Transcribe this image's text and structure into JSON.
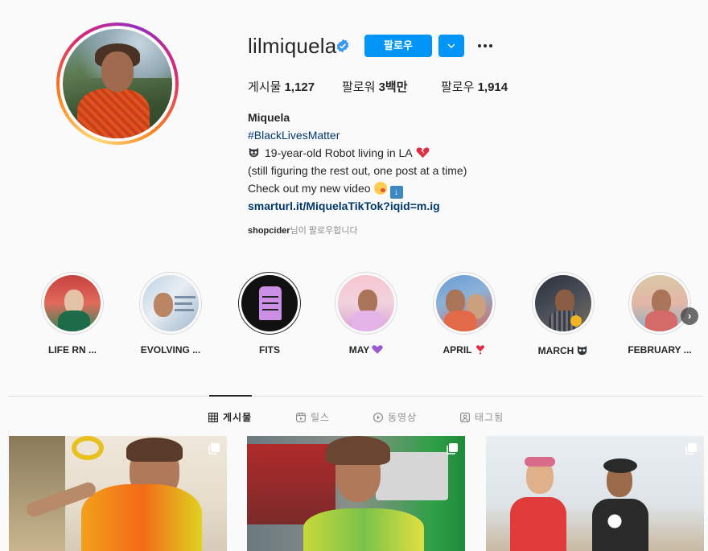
{
  "profile": {
    "username": "lilmiquela",
    "follow_label": "팔로우",
    "stats": {
      "posts_label": "게시물",
      "posts_value": "1,127",
      "followers_label": "팔로워",
      "followers_value": "3백만",
      "following_label": "팔로우",
      "following_value": "1,914"
    },
    "bio": {
      "name": "Miquela",
      "hashtag": "#BlackLivesMatter",
      "line1": "19-year-old Robot living in LA",
      "line2": "(still figuring the rest out, one post at a time)",
      "line3": "Check out my new video",
      "link": "smarturl.it/MiquelaTikTok?iqid=m.ig"
    },
    "followed_by": {
      "user": "shopcider",
      "suffix": "님이 팔로우합니다"
    }
  },
  "highlights": [
    {
      "label": "LIFE RN ..."
    },
    {
      "label": "EVOLVING ..."
    },
    {
      "label": "FITS"
    },
    {
      "label": "MAY"
    },
    {
      "label": "APRIL"
    },
    {
      "label": "MARCH"
    },
    {
      "label": "FEBRUARY ..."
    }
  ],
  "tabs": [
    {
      "label": "게시물",
      "icon": "grid-icon",
      "active": true
    },
    {
      "label": "릴스",
      "icon": "reels-icon",
      "active": false
    },
    {
      "label": "동영상",
      "icon": "play-circle-icon",
      "active": false
    },
    {
      "label": "태그됨",
      "icon": "tag-icon",
      "active": false
    }
  ],
  "colors": {
    "accent": "#0095f6",
    "link": "#00376b",
    "text": "#262626",
    "muted": "#8e8e8e",
    "background": "#fafafa"
  },
  "icons": {
    "verified": "verified-badge-icon",
    "dropdown": "chevron-down-icon",
    "more": "more-options-icon",
    "carousel": "multiple-posts-icon",
    "next": "chevron-right-icon"
  }
}
